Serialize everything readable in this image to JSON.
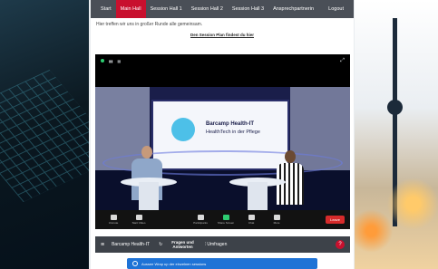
{
  "nav": {
    "tabs": [
      {
        "label": "Start"
      },
      {
        "label": "Main Hall"
      },
      {
        "label": "Session Hall 1"
      },
      {
        "label": "Session Hall 2"
      },
      {
        "label": "Session Hall 3"
      },
      {
        "label": "Ansprechpartnerin"
      }
    ],
    "logout": "Logout"
  },
  "intro_text": "Hier treffen wir uns in großer Runde alle gemeinsam.",
  "session_link": "Den Session Plan findest du hier",
  "video": {
    "screen_title_line1": "Barcamp Health-IT",
    "screen_title_line2": "HealthTech in der Pflege",
    "controls": [
      {
        "label": "Unmute"
      },
      {
        "label": "Start Video"
      },
      {
        "label": "Participants"
      },
      {
        "label": "Share Screen"
      },
      {
        "label": "Chat"
      },
      {
        "label": "More"
      }
    ],
    "leave": "Leave"
  },
  "bottombar": {
    "room": "Barcamp Health-IT",
    "qa_line1": "Fragen und",
    "qa_line2": "Antworten",
    "polls": "Umfragen"
  },
  "welcome": "Aussee Wrap up der einzelnen sessions"
}
